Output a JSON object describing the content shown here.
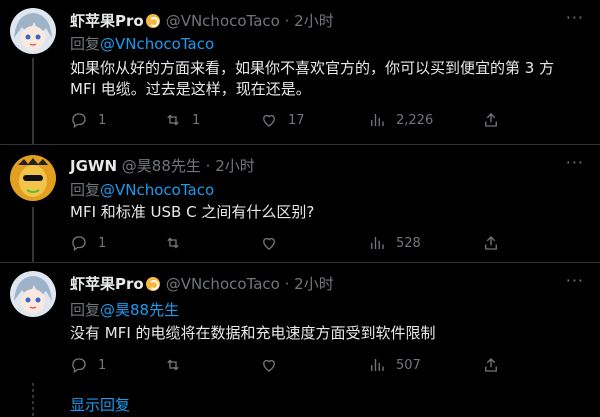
{
  "tweets": [
    {
      "name": "虾苹果Pro",
      "handle": "@VNchocoTaco",
      "time": "· 2小时",
      "reply_prefix": "回复",
      "reply_to": "@VNchocoTaco",
      "text": "如果你从好的方面来看，如果你不喜欢官方的，你可以买到便宜的第 3 方 MFI 电缆。过去是这样，现在还是。",
      "replies": "1",
      "retweets": "1",
      "likes": "17",
      "views": "2,226"
    },
    {
      "name": "JGWN",
      "handle": "@昊88先生",
      "time": "· 2小时",
      "reply_prefix": "回复",
      "reply_to": "@VNchocoTaco",
      "text": "MFI 和标准 USB C 之间有什么区别?",
      "replies": "1",
      "retweets": "",
      "likes": "",
      "views": "528"
    },
    {
      "name": "虾苹果Pro",
      "handle": "@VNchocoTaco",
      "time": "· 2小时",
      "reply_prefix": "回复",
      "reply_to": "@昊88先生",
      "text": "没有 MFI 的电缆将在数据和充电速度方面受到软件限制",
      "replies": "1",
      "retweets": "",
      "likes": "",
      "views": "507"
    }
  ],
  "more_label": "···",
  "show_replies": "显示回复",
  "icons": [
    "reply-icon",
    "retweet-icon",
    "like-icon",
    "views-icon",
    "share-icon"
  ],
  "colors": {
    "link": "#1d9bf0",
    "muted": "#71767b",
    "text": "#e7e9ea",
    "background": "#000000"
  }
}
